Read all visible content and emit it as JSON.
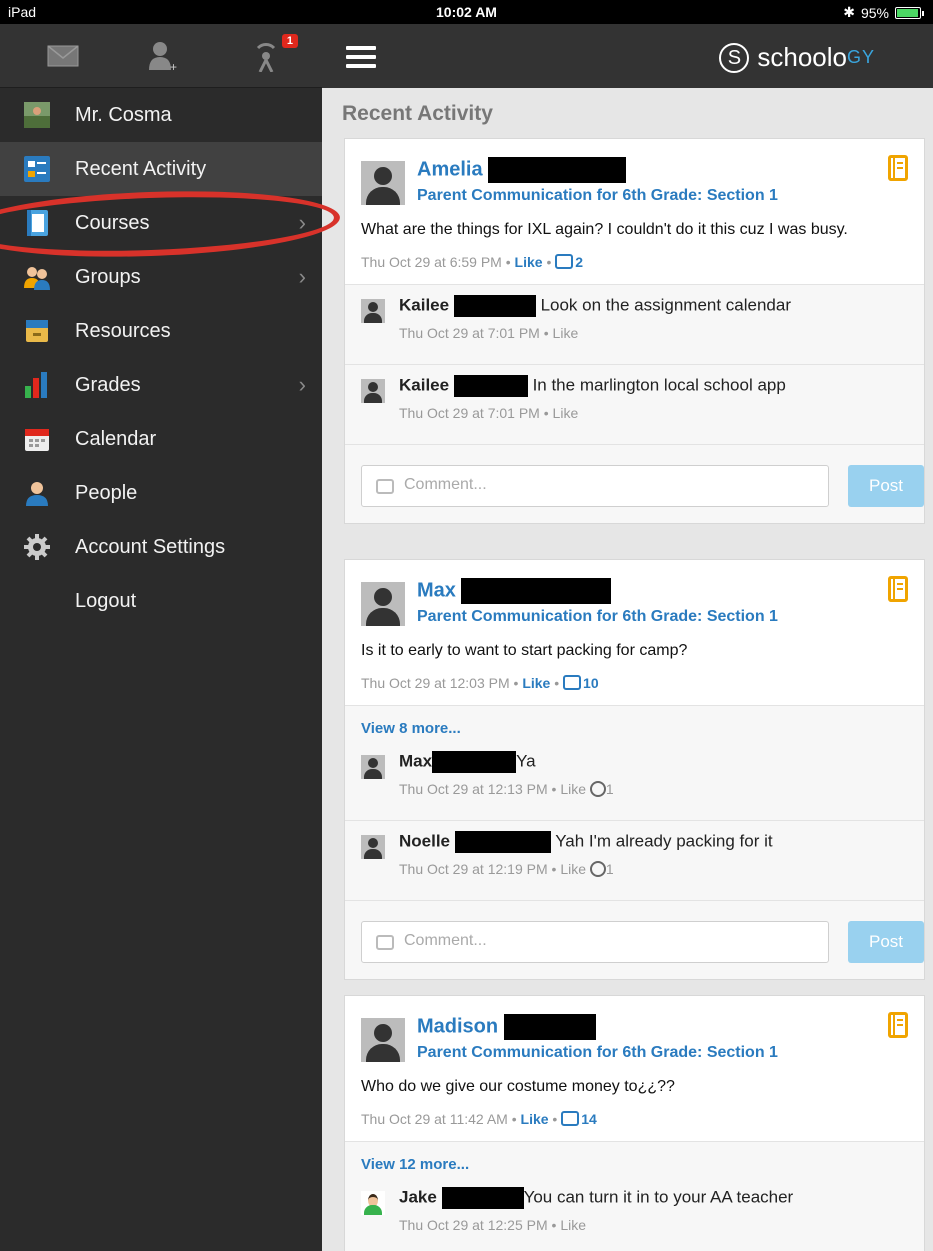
{
  "status": {
    "device": "iPad",
    "time": "10:02 AM",
    "battery": "95%"
  },
  "tools": {
    "notifications_badge": "1"
  },
  "sidebar": {
    "items": [
      {
        "label": "Mr. Cosma"
      },
      {
        "label": "Recent Activity"
      },
      {
        "label": "Courses"
      },
      {
        "label": "Groups"
      },
      {
        "label": "Resources"
      },
      {
        "label": "Grades"
      },
      {
        "label": "Calendar"
      },
      {
        "label": "People"
      },
      {
        "label": "Account Settings"
      },
      {
        "label": "Logout"
      }
    ]
  },
  "header": {
    "logo_main": "schoolo",
    "logo_accent": "GY",
    "page_title": "Recent Activity"
  },
  "posts": [
    {
      "author": "Amelia",
      "context": "Parent Communication for 6th Grade: Section 1",
      "body": "What are the things for IXL again? I couldn't do it this cuz I was busy.",
      "time": "Thu Oct 29 at 6:59 PM",
      "like": "Like",
      "comment_count": "2",
      "comments": [
        {
          "name": "Kailee",
          "text": "Look on the assignment calendar",
          "time": "Thu Oct 29 at 7:01 PM",
          "like": "Like"
        },
        {
          "name": "Kailee",
          "text": "In the marlington local school app",
          "time": "Thu Oct 29 at 7:01 PM",
          "like": "Like"
        }
      ]
    },
    {
      "author": "Max",
      "context": "Parent Communication for 6th Grade: Section 1",
      "body": "Is it to early to want to start packing for camp?",
      "time": "Thu Oct 29 at 12:03 PM",
      "like": "Like",
      "comment_count": "10",
      "view_more": "View 8 more...",
      "comments": [
        {
          "name": "Max",
          "text": "Ya",
          "time": "Thu Oct 29 at 12:13 PM",
          "like": "Like",
          "likes": "1"
        },
        {
          "name": "Noelle",
          "text": "Yah I'm already packing for it",
          "time": "Thu Oct 29 at 12:19 PM",
          "like": "Like",
          "likes": "1"
        }
      ]
    },
    {
      "author": "Madison",
      "context": "Parent Communication for 6th Grade: Section 1",
      "body": "Who do we give our costume money to¿¿??",
      "time": "Thu Oct 29 at 11:42 AM",
      "like": "Like",
      "comment_count": "14",
      "view_more": "View 12 more...",
      "comments": [
        {
          "name": "Jake",
          "text": "You can turn it in to your AA teacher",
          "time": "Thu Oct 29 at 12:25 PM",
          "like": "Like"
        }
      ]
    }
  ],
  "composer": {
    "placeholder": "Comment...",
    "post_label": "Post"
  },
  "colors": {
    "accent": "#2a7bbf",
    "sidebar": "#2b2b2b",
    "annotation": "#d8322a"
  }
}
